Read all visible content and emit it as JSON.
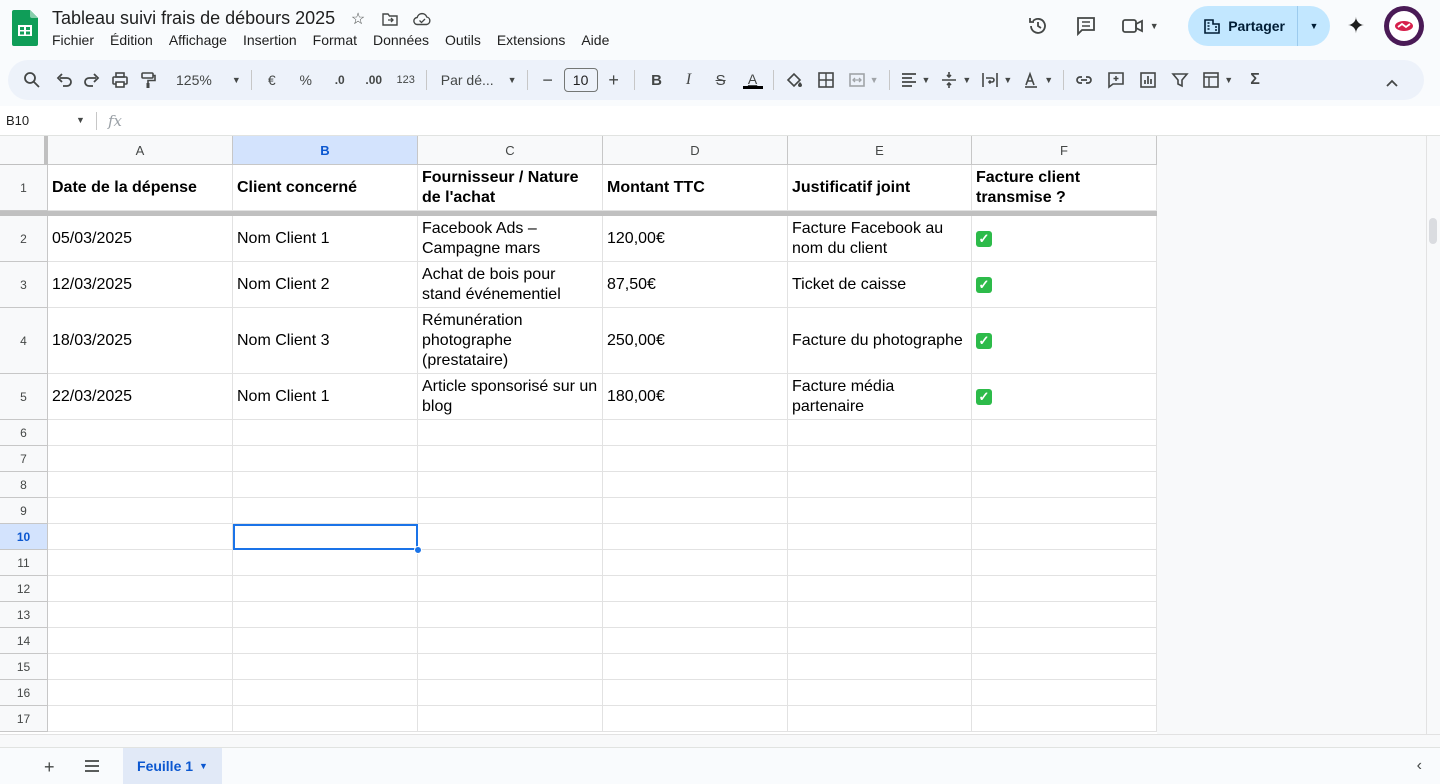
{
  "app": {
    "doc_title": "Tableau suivi frais de débours 2025",
    "menu": [
      "Fichier",
      "Édition",
      "Affichage",
      "Insertion",
      "Format",
      "Données",
      "Outils",
      "Extensions",
      "Aide"
    ],
    "share_label": "Partager"
  },
  "toolbar": {
    "zoom": "125%",
    "currency": "€",
    "percent": "%",
    "dec_decrease": ".0",
    "dec_increase": ".00",
    "number_format": "123",
    "font_family": "Par dé...",
    "font_size": "10"
  },
  "formula_bar": {
    "name_box": "B10",
    "fx": "fx"
  },
  "columns": [
    "A",
    "B",
    "C",
    "D",
    "E",
    "F"
  ],
  "selected_column": "B",
  "selected_row": "10",
  "row_numbers": [
    "1",
    "2",
    "3",
    "4",
    "5",
    "6",
    "7",
    "8",
    "9",
    "10",
    "11",
    "12",
    "13",
    "14",
    "15",
    "16",
    "17"
  ],
  "headers": [
    "Date de la dépense",
    "Client concerné",
    "Fournisseur / Nature de l'achat",
    "Montant TTC",
    "Justificatif joint",
    "Facture client transmise ?"
  ],
  "rows": [
    [
      "05/03/2025",
      "Nom Client 1",
      "Facebook Ads – Campagne mars",
      "120,00€",
      "Facture Facebook au nom du client",
      "✓"
    ],
    [
      "12/03/2025",
      "Nom Client 2",
      "Achat de bois pour stand événementiel",
      "87,50€",
      "Ticket de caisse",
      "✓"
    ],
    [
      "18/03/2025",
      "Nom Client 3",
      "Rémunération photographe (prestataire)",
      "250,00€",
      "Facture du photographe",
      "✓"
    ],
    [
      "22/03/2025",
      "Nom Client 1",
      "Article sponsorisé sur un blog",
      "180,00€",
      "Facture média partenaire",
      "✓"
    ]
  ],
  "sheet_tab": "Feuille 1",
  "colors": {
    "accent": "#1a73e8",
    "share_bg": "#c2e7ff",
    "check_green": "#2dbb4a",
    "logo_green": "#0f9d58",
    "avatar_bg": "#4a1a56"
  }
}
